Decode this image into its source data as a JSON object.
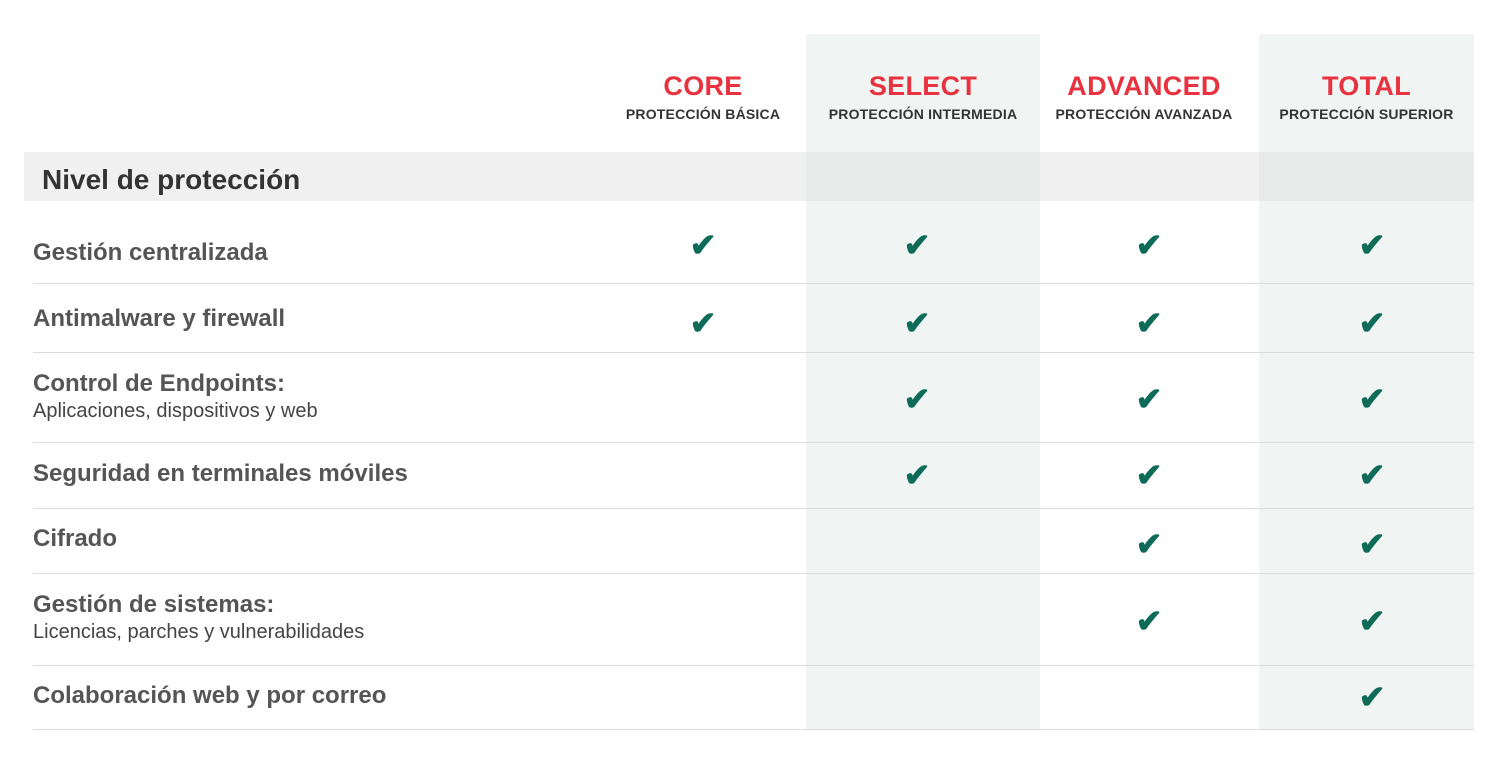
{
  "tiers": [
    {
      "name": "CORE",
      "desc": "PROTECCIÓN BÁSICA"
    },
    {
      "name": "SELECT",
      "desc": "PROTECCIÓN INTERMEDIA"
    },
    {
      "name": "ADVANCED",
      "desc": "PROTECCIÓN AVANZADA"
    },
    {
      "name": "TOTAL",
      "desc": "PROTECCIÓN SUPERIOR"
    }
  ],
  "section": {
    "title": "Nivel de protección"
  },
  "check_glyph": "✔",
  "colors": {
    "accent": "#e8323f",
    "check": "#0e6b58",
    "shade": "#f0f5f3"
  },
  "rows": [
    {
      "label": "Gestión centralizada",
      "sub": "",
      "checks": [
        true,
        true,
        true,
        true
      ]
    },
    {
      "label": "Antimalware y firewall",
      "sub": "",
      "checks": [
        true,
        true,
        true,
        true
      ]
    },
    {
      "label": "Control de Endpoints:",
      "sub": "Aplicaciones, dispositivos y web",
      "checks": [
        false,
        true,
        true,
        true
      ]
    },
    {
      "label": "Seguridad en terminales móviles",
      "sub": "",
      "checks": [
        false,
        true,
        true,
        true
      ]
    },
    {
      "label": "Cifrado",
      "sub": "",
      "checks": [
        false,
        false,
        true,
        true
      ]
    },
    {
      "label": "Gestión de sistemas:",
      "sub": "Licencias, parches y vulnerabilidades",
      "checks": [
        false,
        false,
        true,
        true
      ]
    },
    {
      "label": "Colaboración web y por correo",
      "sub": "",
      "checks": [
        false,
        false,
        false,
        true
      ]
    }
  ]
}
